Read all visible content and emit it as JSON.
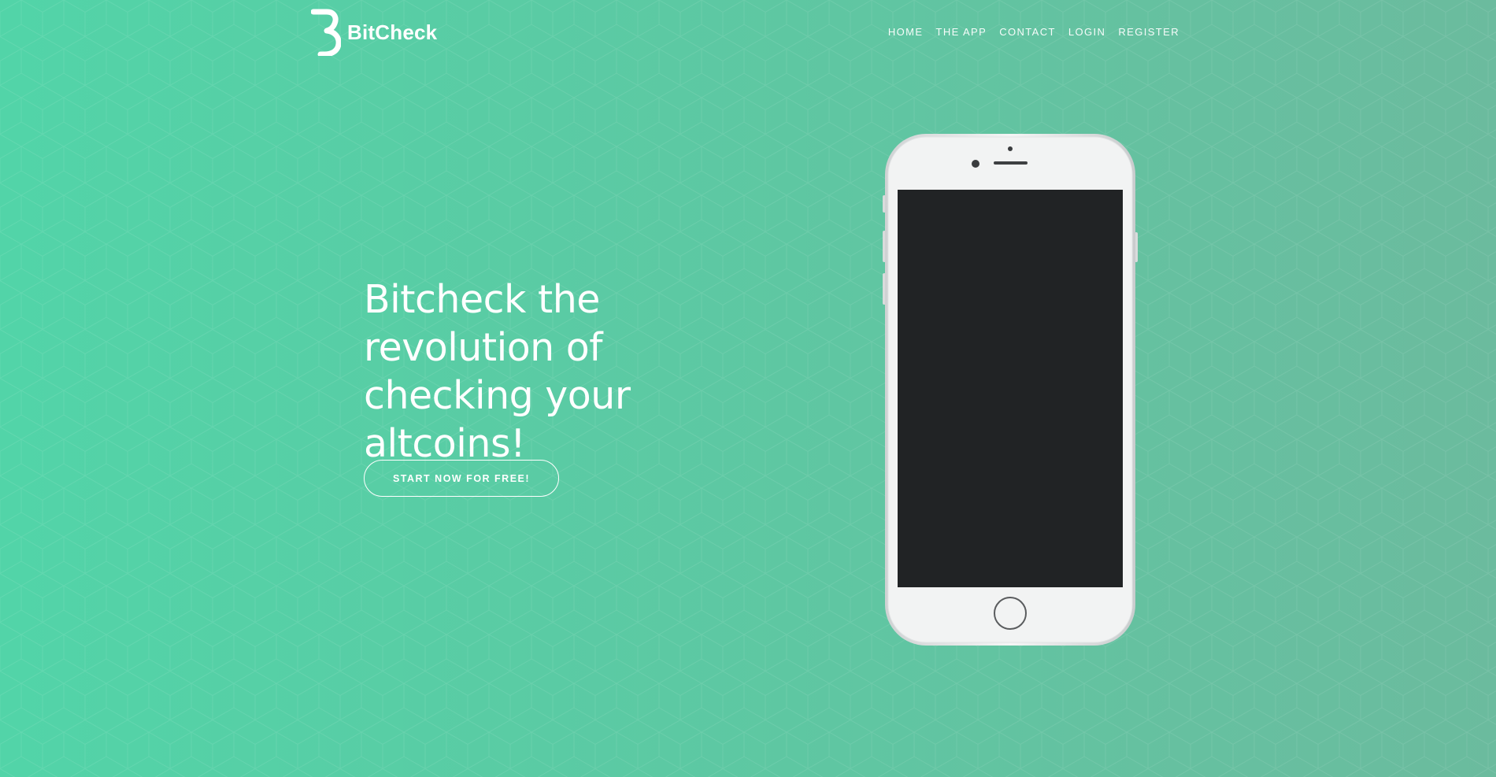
{
  "brand": {
    "name": "BitCheck",
    "logo_icon": "b-logo-mark"
  },
  "nav": {
    "items": [
      {
        "label": "HOME"
      },
      {
        "label": "THE APP"
      },
      {
        "label": "CONTACT"
      },
      {
        "label": "LOGIN"
      },
      {
        "label": "REGISTER"
      }
    ]
  },
  "hero": {
    "headline": "Bitcheck the revolution of checking your altcoins!",
    "cta_label": "START NOW FOR FREE!"
  },
  "theme": {
    "bg_left": "#52d4a8",
    "bg_right": "#6bbb9e",
    "text": "#ffffff",
    "phone_screen": "#212325",
    "phone_body": "#f2f3f3"
  }
}
